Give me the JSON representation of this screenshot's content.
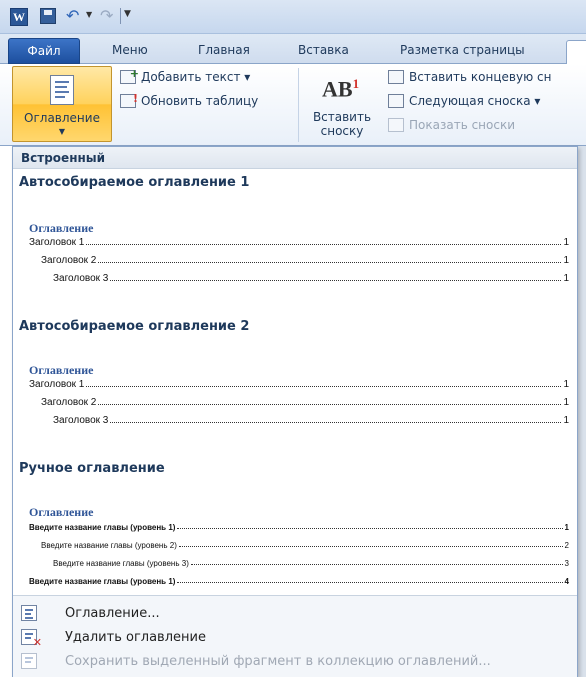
{
  "quick_access": {
    "app_logo": "W",
    "icons": [
      "word-logo-icon",
      "save-icon",
      "undo-icon",
      "redo-icon",
      "customize-icon"
    ]
  },
  "tabs": [
    {
      "label": "Файл"
    },
    {
      "label": "Меню"
    },
    {
      "label": "Главная"
    },
    {
      "label": "Вставка"
    },
    {
      "label": "Разметка страницы"
    }
  ],
  "ribbon": {
    "toc_button": "Оглавление",
    "add_text": "Добавить текст ▾",
    "update_table": "Обновить таблицу",
    "insert_footnote_line1": "Вставить",
    "insert_footnote_line2": "сноску",
    "insert_endnote": "Вставить концевую сн",
    "next_footnote": "Следующая сноска ▾",
    "show_notes": "Показать сноски",
    "ab_text": "AB",
    "ab_sup": "1"
  },
  "gallery": {
    "header": "Встроенный",
    "sections": [
      {
        "title": "Автособираемое оглавление 1",
        "preview_title": "Оглавление",
        "lines": [
          {
            "text": "Заголовок 1",
            "page": "1"
          },
          {
            "text": "Заголовок 2",
            "page": "1"
          },
          {
            "text": "Заголовок 3",
            "page": "1"
          }
        ]
      },
      {
        "title": "Автособираемое оглавление 2",
        "preview_title": "Оглавление",
        "lines": [
          {
            "text": "Заголовок 1",
            "page": "1"
          },
          {
            "text": "Заголовок 2",
            "page": "1"
          },
          {
            "text": "Заголовок 3",
            "page": "1"
          }
        ]
      },
      {
        "title": "Ручное оглавление",
        "preview_title": "Оглавление",
        "lines": [
          {
            "text": "Введите название главы (уровень 1)",
            "page": "1"
          },
          {
            "text": "Введите название главы (уровень 2)",
            "page": "2"
          },
          {
            "text": "Введите название главы (уровень 3)",
            "page": "3"
          },
          {
            "text": "Введите название главы (уровень 1)",
            "page": "4"
          }
        ]
      }
    ],
    "footer": [
      {
        "label": "Оглавление...",
        "enabled": true
      },
      {
        "label": "Удалить оглавление",
        "enabled": true
      },
      {
        "label": "Сохранить выделенный фрагмент в коллекцию оглавлений...",
        "enabled": false
      }
    ]
  },
  "colors": {
    "file_tab": "#2b62b6",
    "toc_highlight": "#ffd25c",
    "preview_heading": "#2f5597"
  }
}
